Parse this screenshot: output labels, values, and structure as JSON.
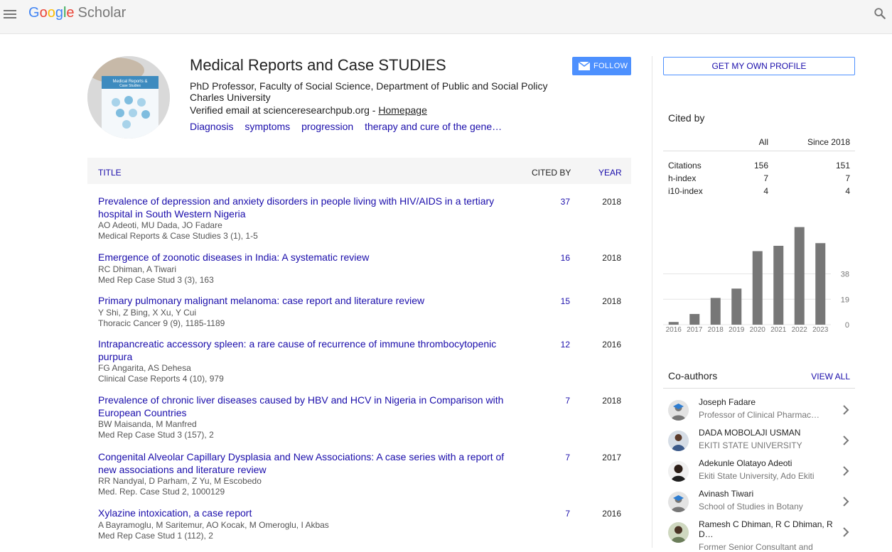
{
  "header": {
    "logo_letters": [
      "G",
      "o",
      "o",
      "g",
      "l",
      "e"
    ],
    "logo_product": "Scholar",
    "icons": {
      "menu": "menu-icon",
      "search": "search-icon"
    }
  },
  "profile": {
    "name": "Medical Reports and Case STUDIES",
    "affiliation": "PhD Professor, Faculty of Social Science, Department of Public and Social Policy",
    "institution": "Charles University",
    "verified_email": "Verified email at scienceresearchpub.org - ",
    "homepage_label": "Homepage",
    "interests": [
      "Diagnosis",
      "symptoms",
      "progression",
      "therapy and cure of the gene…"
    ],
    "follow_label": "FOLLOW",
    "avatar_cover_text": [
      "Medical Reports &",
      "Case Studies"
    ]
  },
  "table": {
    "headers": {
      "title": "TITLE",
      "cited_by": "CITED BY",
      "year": "YEAR"
    },
    "articles": [
      {
        "title": "Prevalence of depression and anxiety disorders in people living with HIV/AIDS in a tertiary hospital in South Western Nigeria",
        "authors": "AO Adeoti, MU Dada, JO Fadare",
        "venue": "Medical Reports & Case Studies 3 (1), 1-5",
        "cited_by": "37",
        "year": "2018"
      },
      {
        "title": "Emergence of zoonotic diseases in India: A systematic review",
        "authors": "RC Dhiman, A Tiwari",
        "venue": "Med Rep Case Stud 3 (3), 163",
        "cited_by": "16",
        "year": "2018"
      },
      {
        "title": "Primary pulmonary malignant melanoma: case report and literature review",
        "authors": "Y Shi, Z Bing, X Xu, Y Cui",
        "venue": "Thoracic Cancer 9 (9), 1185-1189",
        "cited_by": "15",
        "year": "2018"
      },
      {
        "title": "Intrapancreatic accessory spleen: a rare cause of recurrence of immune thrombocytopenic purpura",
        "authors": "FG Angarita, AS Dehesa",
        "venue": "Clinical Case Reports 4 (10), 979",
        "cited_by": "12",
        "year": "2016"
      },
      {
        "title": "Prevalence of chronic liver diseases caused by HBV and HCV in Nigeria in Comparison with European Countries",
        "authors": "BW Maisanda, M Manfred",
        "venue": "Med Rep Case Stud 3 (157), 2",
        "cited_by": "7",
        "year": "2018"
      },
      {
        "title": "Congenital Alveolar Capillary Dysplasia and New Associations: A case series with a report of new associations and literature review",
        "authors": "RR Nandyal, D Parham, Z Yu, M Escobedo",
        "venue": "Med. Rep. Case Stud 2, 1000129",
        "cited_by": "7",
        "year": "2017"
      },
      {
        "title": "Xylazine intoxication, a case report",
        "authors": "A Bayramoglu, M Saritemur, AO Kocak, M Omeroglu, I Akbas",
        "venue": "Med Rep Case Stud 1 (112), 2",
        "cited_by": "7",
        "year": "2016"
      }
    ]
  },
  "sidebar": {
    "get_profile_label": "GET MY OWN PROFILE",
    "cited_by_title": "Cited by",
    "stats_headers": {
      "all": "All",
      "since": "Since 2018"
    },
    "stats": [
      {
        "label": "Citations",
        "all": "156",
        "since": "151"
      },
      {
        "label": "h-index",
        "all": "7",
        "since": "7"
      },
      {
        "label": "i10-index",
        "all": "4",
        "since": "4"
      }
    ],
    "coauthors_title": "Co-authors",
    "view_all_label": "VIEW ALL",
    "coauthors": [
      {
        "name": "Joseph Fadare",
        "affiliation": "Professor of Clinical Pharmac…",
        "avatar": "placeholder-avatar"
      },
      {
        "name": "DADA MOBOLAJI USMAN",
        "affiliation": "EKITI STATE UNIVERSITY",
        "avatar": "photo-avatar"
      },
      {
        "name": "Adekunle Olatayo Adeoti",
        "affiliation": "Ekiti State University, Ado Ekiti",
        "avatar": "photo-avatar"
      },
      {
        "name": "Avinash Tiwari",
        "affiliation": "School of Studies in Botany",
        "avatar": "placeholder-avatar"
      },
      {
        "name": "Ramesh C Dhiman, R C Dhiman, R D…",
        "affiliation": "Former Senior Consultant and",
        "avatar": "photo-avatar"
      }
    ]
  },
  "chart_data": {
    "type": "bar",
    "categories": [
      "2016",
      "2017",
      "2018",
      "2019",
      "2020",
      "2021",
      "2022",
      "2023"
    ],
    "values": [
      2,
      8,
      20,
      27,
      55,
      59,
      73,
      61
    ],
    "y_ticks": [
      "0",
      "19",
      "38"
    ],
    "ylim": [
      0,
      76
    ],
    "bar_color": "#777777"
  }
}
